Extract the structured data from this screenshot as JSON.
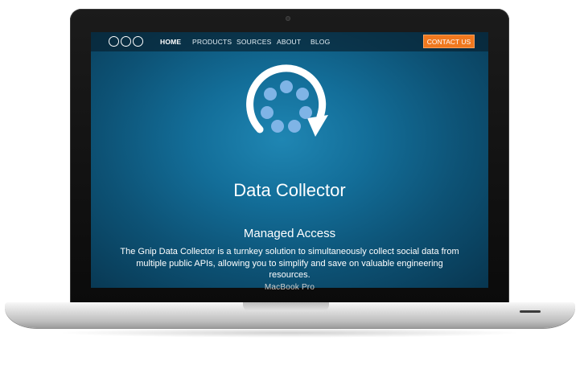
{
  "device": {
    "brand_label": "MacBook Pro"
  },
  "nav": {
    "items": [
      {
        "label": "HOME",
        "active": true
      },
      {
        "label": "PRODUCTS",
        "active": false
      },
      {
        "label": "SOURCES",
        "active": false
      },
      {
        "label": "ABOUT",
        "active": false
      },
      {
        "label": "BLOG",
        "active": false
      }
    ],
    "contact_label": "CONTACT US",
    "logo_icon": "three-circles-logo-icon"
  },
  "hero": {
    "icon": "circular-refresh-dots-icon",
    "title": "Data Collector",
    "subtitle": "Managed Access",
    "description": "The Gnip Data Collector is a turnkey solution to simultaneously collect social data from multiple public APIs, allowing you to simplify and save on valuable engineering resources."
  },
  "colors": {
    "accent": "#f0781e",
    "screen_bg": "#136e99",
    "dots": "#7fb4e6"
  }
}
